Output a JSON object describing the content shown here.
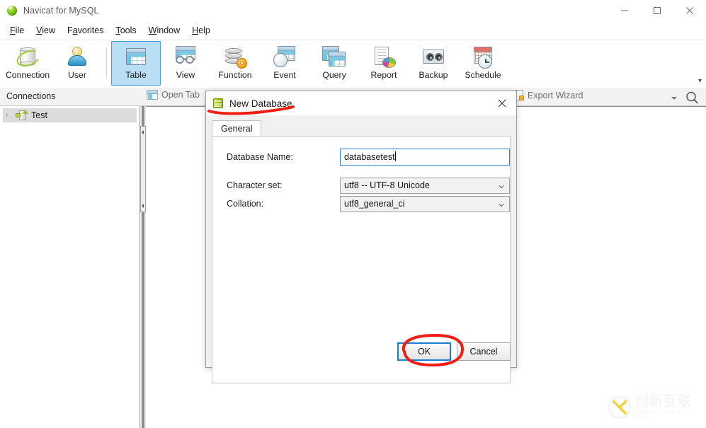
{
  "window": {
    "title": "Navicat for MySQL",
    "app_icon": "navicat-logo-icon",
    "controls": {
      "minimize": "minimize-icon",
      "maximize": "maximize-icon",
      "close": "close-icon"
    }
  },
  "menubar": {
    "items": [
      {
        "label": "File",
        "mnemonic": "F"
      },
      {
        "label": "View",
        "mnemonic": "V"
      },
      {
        "label": "Favorites",
        "mnemonic": "a"
      },
      {
        "label": "Tools",
        "mnemonic": "T"
      },
      {
        "label": "Window",
        "mnemonic": "W"
      },
      {
        "label": "Help",
        "mnemonic": "H"
      }
    ]
  },
  "toolbar": {
    "overflow_label": "▾",
    "groups": [
      {
        "buttons": [
          {
            "label": "Connection",
            "icon": "connection-icon",
            "selected": false
          },
          {
            "label": "User",
            "icon": "user-icon",
            "selected": false
          }
        ]
      },
      {
        "buttons": [
          {
            "label": "Table",
            "icon": "table-icon",
            "selected": true
          },
          {
            "label": "View",
            "icon": "view-icon",
            "selected": false
          },
          {
            "label": "Function",
            "icon": "function-icon",
            "selected": false
          },
          {
            "label": "Event",
            "icon": "event-icon",
            "selected": false
          },
          {
            "label": "Query",
            "icon": "query-icon",
            "selected": false
          },
          {
            "label": "Report",
            "icon": "report-icon",
            "selected": false
          },
          {
            "label": "Backup",
            "icon": "backup-icon",
            "selected": false
          },
          {
            "label": "Schedule",
            "icon": "schedule-icon",
            "selected": false
          }
        ]
      }
    ]
  },
  "strip": {
    "connections_label": "Connections",
    "open_tab_label": "Open Tab",
    "export_wizard_label": "Export Wizard",
    "search_icon": "search-icon",
    "caret_icon": "chevron-down-icon"
  },
  "sidebar": {
    "items": [
      {
        "label": "Test",
        "icon": "connection-node-icon",
        "expanded": false,
        "selected": true,
        "chevron": "›"
      }
    ]
  },
  "dialog": {
    "title": "New Database",
    "icon": "database-icon",
    "close_icon": "close-icon",
    "tabs": [
      {
        "label": "General",
        "active": true
      }
    ],
    "fields": {
      "database_name": {
        "label": "Database Name:",
        "value": "databasetest",
        "placeholder": ""
      },
      "character_set": {
        "label": "Character set:",
        "value": "utf8 -- UTF-8 Unicode"
      },
      "collation": {
        "label": "Collation:",
        "value": "utf8_general_ci"
      }
    },
    "buttons": {
      "ok": "OK",
      "cancel": "Cancel"
    }
  },
  "annotations": {
    "color": "#f41c10",
    "marks": [
      {
        "type": "underline",
        "target": "dialog-title"
      },
      {
        "type": "circle",
        "target": "ok-button"
      }
    ]
  },
  "watermark": {
    "chinese": "创新互联",
    "pinyin": "CHUANG XIN HU LIAN"
  },
  "colors": {
    "accent_selected": "#b9ddf5",
    "accent_border": "#4a9ed6",
    "focus_blue": "#1a7fd4",
    "annotation_red": "#f41c10",
    "dialog_bg": "#f0f0f0"
  }
}
